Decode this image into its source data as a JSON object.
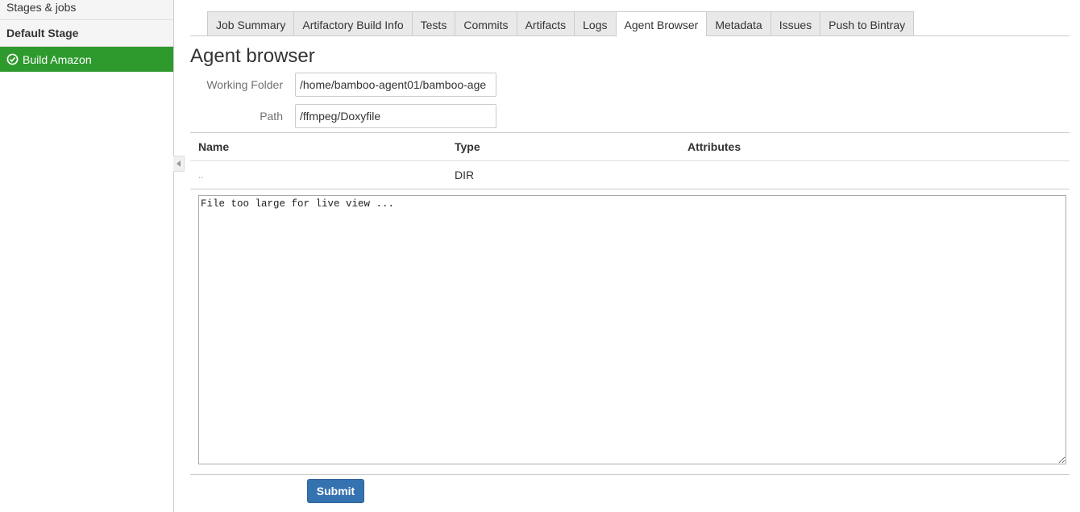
{
  "sidebar": {
    "title": "Stages & jobs",
    "stage_name": "Default Stage",
    "job": {
      "label": "Build Amazon",
      "status": "success",
      "icon": "check-circle-icon",
      "color": "#2e9a2e"
    }
  },
  "tabs": [
    {
      "label": "Job Summary",
      "active": false
    },
    {
      "label": "Artifactory Build Info",
      "active": false
    },
    {
      "label": "Tests",
      "active": false
    },
    {
      "label": "Commits",
      "active": false
    },
    {
      "label": "Artifacts",
      "active": false
    },
    {
      "label": "Logs",
      "active": false
    },
    {
      "label": "Agent Browser",
      "active": true
    },
    {
      "label": "Metadata",
      "active": false
    },
    {
      "label": "Issues",
      "active": false
    },
    {
      "label": "Push to Bintray",
      "active": false
    }
  ],
  "main": {
    "title": "Agent browser",
    "working_folder": {
      "label": "Working Folder",
      "value": "/home/bamboo-agent01/bamboo-age"
    },
    "path": {
      "label": "Path",
      "value": "/ffmpeg/Doxyfile"
    },
    "table": {
      "headers": {
        "name": "Name",
        "type": "Type",
        "attributes": "Attributes"
      },
      "rows": [
        {
          "name": "..",
          "type": "DIR",
          "attributes": ""
        }
      ]
    },
    "viewer_text": "File too large for live view ...",
    "submit_label": "Submit",
    "accent_color": "#3572b0"
  }
}
